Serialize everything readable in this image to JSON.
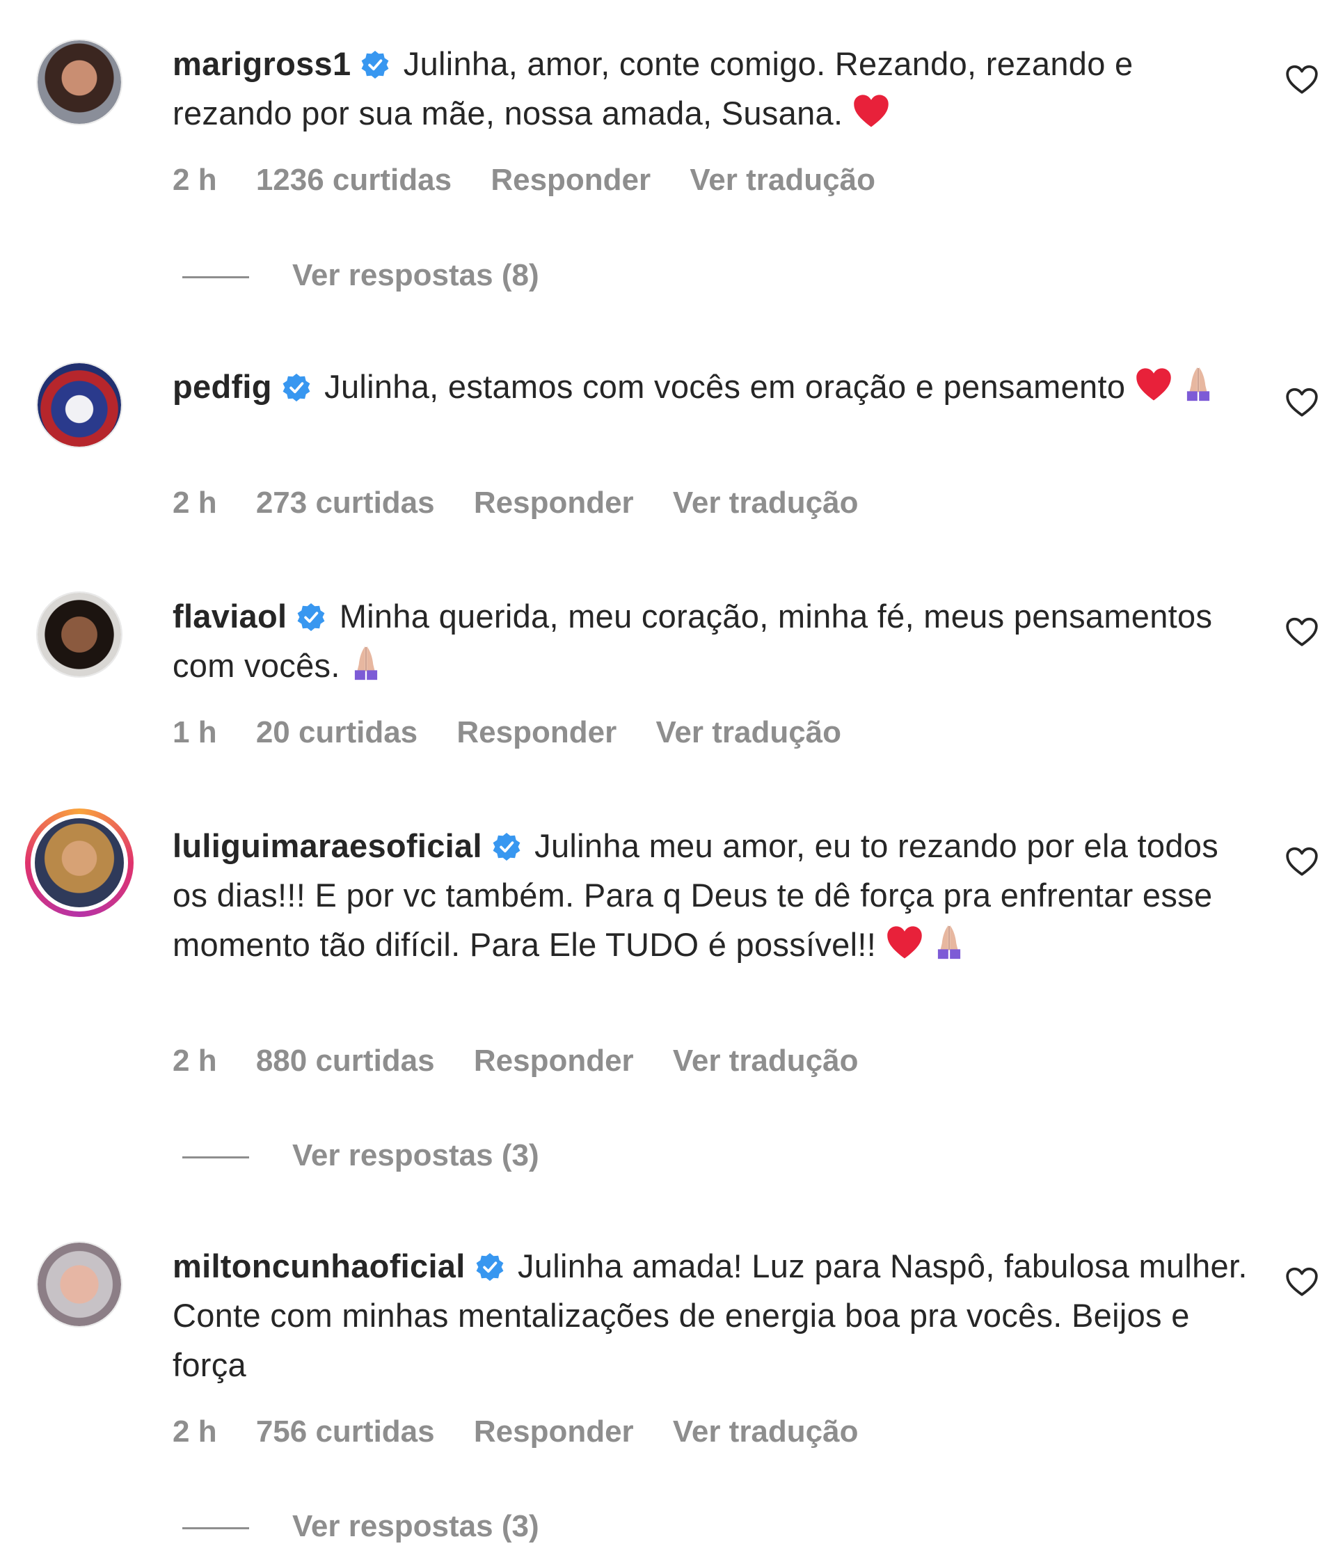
{
  "colors": {
    "text": "#262626",
    "secondary": "#8e8e8e",
    "verified": "#3897f0",
    "heart_red": "#e8213a"
  },
  "comments": [
    {
      "username": "marigross1",
      "text": "Julinha, amor, conte comigo. Rezando, rezando e rezando por sua mãe, nossa amada, Susana.",
      "emojis": [
        "red-heart"
      ],
      "time": "2 h",
      "likes": "1236 curtidas",
      "reply_label": "Responder",
      "translate_label": "Ver tradução",
      "view_replies": "Ver respostas (8)"
    },
    {
      "username": "pedfig",
      "text": "Julinha, estamos com vocês em oração e pensamento",
      "emojis": [
        "red-heart",
        "praying-hands"
      ],
      "time": "2 h",
      "likes": "273 curtidas",
      "reply_label": "Responder",
      "translate_label": "Ver tradução"
    },
    {
      "username": "flaviaol",
      "text": "Minha querida, meu coração, minha fé, meus pensamentos com vocês.",
      "emojis": [
        "praying-hands"
      ],
      "time": "1 h",
      "likes": "20 curtidas",
      "reply_label": "Responder",
      "translate_label": "Ver tradução"
    },
    {
      "username": "luliguimaraesoficial",
      "text": "Julinha meu amor, eu to rezando por ela todos os dias!!! E por vc também. Para q Deus te dê força pra enfrentar esse momento tão difícil. Para Ele TUDO é possível!!",
      "emojis": [
        "red-heart",
        "praying-hands"
      ],
      "time": "2 h",
      "likes": "880 curtidas",
      "reply_label": "Responder",
      "translate_label": "Ver tradução",
      "view_replies": "Ver respostas (3)"
    },
    {
      "username": "miltoncunhaoficial",
      "text": "Julinha amada! Luz para Naspô, fabulosa mulher. Conte com minhas mentalizações de energia boa pra vocês. Beijos e força",
      "emojis": [],
      "time": "2 h",
      "likes": "756 curtidas",
      "reply_label": "Responder",
      "translate_label": "Ver tradução",
      "view_replies": "Ver respostas (3)"
    }
  ]
}
